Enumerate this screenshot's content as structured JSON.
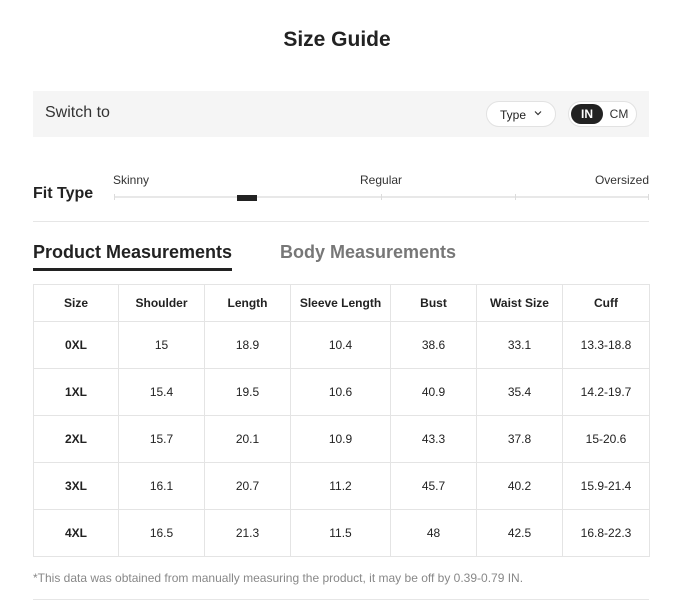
{
  "title": "Size Guide",
  "switch_bar": {
    "label": "Switch to",
    "type_dropdown": {
      "label": "Type",
      "icon": "chevron-down-icon"
    },
    "units": {
      "in": "IN",
      "cm": "CM",
      "selected": "IN"
    }
  },
  "fit": {
    "label": "Fit Type",
    "options": [
      "Skinny",
      "Regular",
      "Oversized"
    ]
  },
  "tabs": {
    "product": "Product Measurements",
    "body": "Body Measurements",
    "active": "product"
  },
  "table": {
    "headers": [
      "Size",
      "Shoulder",
      "Length",
      "Sleeve Length",
      "Bust",
      "Waist Size",
      "Cuff"
    ],
    "rows": [
      [
        "0XL",
        "15",
        "18.9",
        "10.4",
        "38.6",
        "33.1",
        "13.3-18.8"
      ],
      [
        "1XL",
        "15.4",
        "19.5",
        "10.6",
        "40.9",
        "35.4",
        "14.2-19.7"
      ],
      [
        "2XL",
        "15.7",
        "20.1",
        "10.9",
        "43.3",
        "37.8",
        "15-20.6"
      ],
      [
        "3XL",
        "16.1",
        "20.7",
        "11.2",
        "45.7",
        "40.2",
        "15.9-21.4"
      ],
      [
        "4XL",
        "16.5",
        "21.3",
        "11.5",
        "48",
        "42.5",
        "16.8-22.3"
      ]
    ]
  },
  "note": "*This data was obtained from manually measuring the product, it may be off by 0.39-0.79 IN.",
  "colors": {
    "text": "#222222",
    "accent": "#222222",
    "panel": "#f5f5f5",
    "muted": "#888888"
  }
}
